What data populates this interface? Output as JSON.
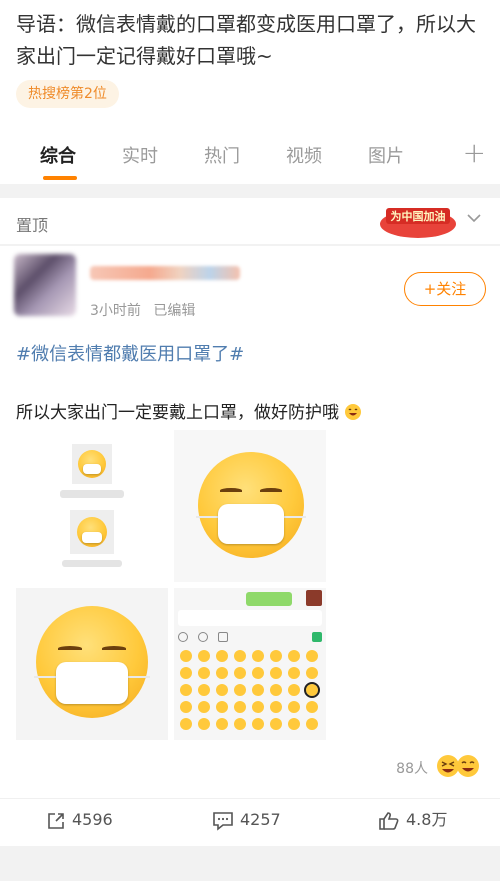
{
  "intro": {
    "text": "导语：微信表情戴的口罩都变成医用口罩了，所以大家出门一定记得戴好口罩哦~"
  },
  "hot_badge": "热搜榜第2位",
  "tabs": [
    {
      "label": "综合"
    },
    {
      "label": "实时"
    },
    {
      "label": "热门"
    },
    {
      "label": "视频"
    },
    {
      "label": "图片"
    }
  ],
  "pinned": {
    "label": "置顶",
    "brand_stamp_text": "为中国加油"
  },
  "post": {
    "time": "3小时前",
    "edited": "已编辑",
    "follow_label": "+关注",
    "topic": "#微信表情都戴医用口罩了#",
    "text": "所以大家出门一定要戴上口罩，做好防护哦",
    "reads": "88人"
  },
  "actions": {
    "repost": "4596",
    "comment": "4257",
    "like": "4.8万"
  },
  "colors": {
    "accent": "#ff8200",
    "link": "#507daf"
  }
}
